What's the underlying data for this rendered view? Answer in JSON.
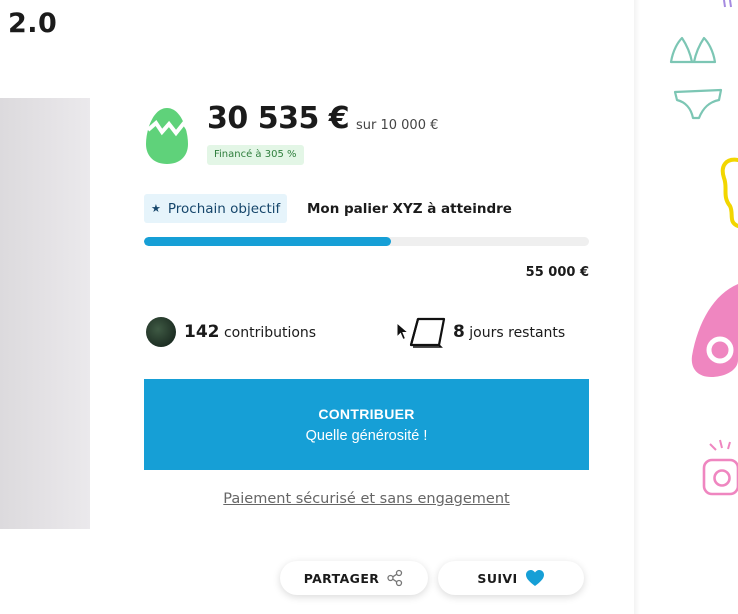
{
  "header": {
    "title": "2.0"
  },
  "funding": {
    "amount": "30 535 €",
    "goal": "sur 10 000 €",
    "funded_label": "Financé à 305 %"
  },
  "next_goal": {
    "star": "★",
    "badge_label": "Prochain objectif",
    "title": "Mon palier XYZ à atteindre",
    "progress": 0.555,
    "target": "55 000 €"
  },
  "stats": {
    "contributions_count": "142",
    "contributions_label": "contributions",
    "days_count": "8",
    "days_label": "jours restants"
  },
  "cta": {
    "label": "CONTRIBUER",
    "sublabel": "Quelle générosité !"
  },
  "secure_link": "Paiement sécurisé et sans engagement",
  "actions": {
    "share_label": "PARTAGER",
    "follow_label": "SUIVI"
  },
  "icons": {
    "egg": "cracked-egg-icon",
    "calendar": "calendar-icon",
    "share": "share-icon",
    "heart": "heart-icon"
  },
  "colors": {
    "accent": "#169fd6",
    "egg_green": "#5fd27a",
    "funded_bg": "#e3f6e6",
    "funded_text": "#2f7f3d",
    "badge_bg": "#e6f4fb"
  }
}
